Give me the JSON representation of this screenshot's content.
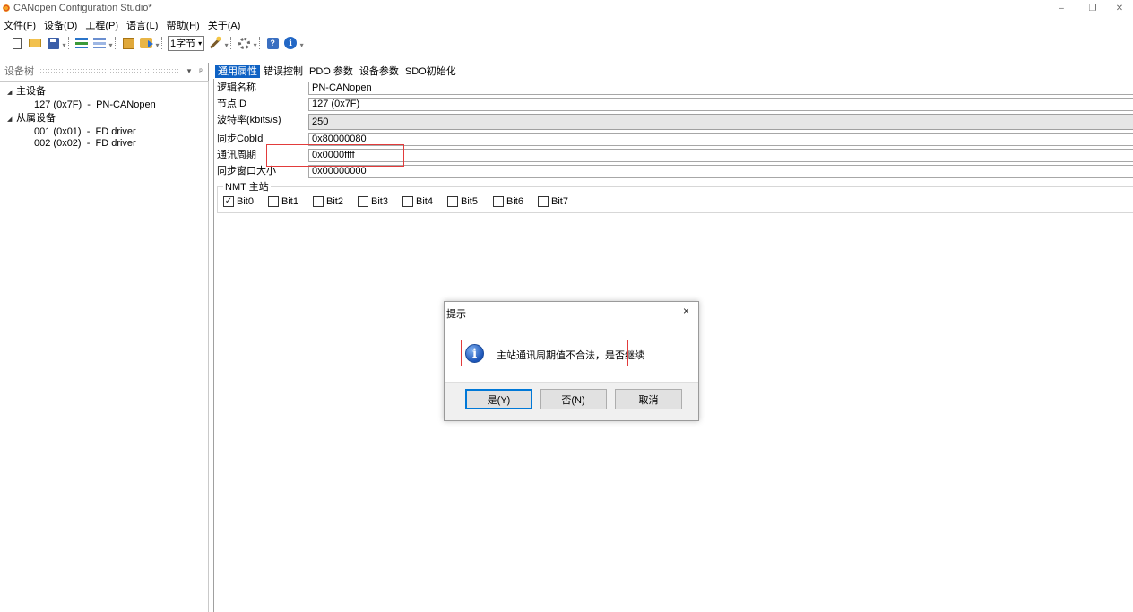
{
  "window": {
    "title": "CANopen Configuration Studio*",
    "minimize_glyph": "–",
    "restore_glyph": "❐",
    "close_glyph": "✕"
  },
  "menu": [
    "文件(F)",
    "设备(D)",
    "工程(P)",
    "语言(L)",
    "帮助(H)",
    "关于(A)"
  ],
  "toolbar": {
    "icons": [
      "new-file-icon",
      "open-folder-icon",
      "save-icon",
      "tree-add-icon",
      "tree-remove-icon",
      "book-icon",
      "export-icon",
      "wand-icon",
      "gear-icon",
      "help-icon",
      "info-icon"
    ],
    "byte_select_value": "1字节",
    "help_glyph": "?",
    "info_glyph": "i"
  },
  "device_tree": {
    "header": "设备树",
    "pin_glyph": "ᵖ",
    "dropdown_glyph": "▾",
    "nodes": [
      {
        "label": "主设备",
        "expanded": true,
        "level": 0
      },
      {
        "label": "127 (0x7F)  -  PN-CANopen",
        "level": 1
      },
      {
        "label": "从属设备",
        "expanded": true,
        "level": 0
      },
      {
        "label": "001 (0x01)  -  FD driver",
        "level": 1
      },
      {
        "label": "002 (0x02)  -  FD driver",
        "level": 1
      }
    ],
    "expand_glyph": "◢"
  },
  "tabs": [
    "通用属性",
    "错误控制",
    "PDO 参数",
    "设备参数",
    "SDO初始化"
  ],
  "active_tab": "通用属性",
  "properties": {
    "logical_name_label": "逻辑名称",
    "logical_name_value": "PN-CANopen",
    "node_id_label": "节点ID",
    "node_id_value": "127 (0x7F)",
    "baudrate_label": "波特率(kbits/s)",
    "baudrate_value": "250",
    "sync_cobid_label": "同步CobId",
    "sync_cobid_value": "0x80000080",
    "comm_period_label": "通讯周期",
    "comm_period_value": "0x0000ffff",
    "sync_window_label": "同步窗口大小",
    "sync_window_value": "0x00000000"
  },
  "nmt": {
    "title": "NMT 主站",
    "bits": [
      {
        "label": "Bit0",
        "checked": true
      },
      {
        "label": "Bit1",
        "checked": false
      },
      {
        "label": "Bit2",
        "checked": false
      },
      {
        "label": "Bit3",
        "checked": false
      },
      {
        "label": "Bit4",
        "checked": false
      },
      {
        "label": "Bit5",
        "checked": false
      },
      {
        "label": "Bit6",
        "checked": false
      },
      {
        "label": "Bit7",
        "checked": false
      }
    ],
    "check_glyph": "✓"
  },
  "dialog": {
    "title": "提示",
    "close_glyph": "×",
    "info_glyph": "i",
    "message": "主站通讯周期值不合法，是否继续",
    "yes_label": "是(Y)",
    "no_label": "否(N)",
    "cancel_label": "取消"
  },
  "colors": {
    "active_tab": "#0f62c4",
    "highlight_frame": "#e23b3b",
    "default_button_border": "#0078d7"
  }
}
